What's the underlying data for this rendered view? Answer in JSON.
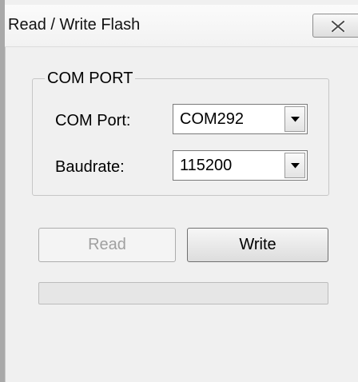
{
  "window": {
    "title": "Read / Write Flash"
  },
  "title_bar": {
    "close_icon": "close-x-icon"
  },
  "com_group": {
    "legend": "COM PORT",
    "port": {
      "label": "COM Port:",
      "value": "COM292",
      "arrow_icon": "chevron-down-icon"
    },
    "baud": {
      "label": "Baudrate:",
      "value": "115200",
      "arrow_icon": "chevron-down-icon"
    }
  },
  "buttons": {
    "read_label": "Read",
    "read_enabled": false,
    "write_label": "Write",
    "write_enabled": true
  },
  "progress": {
    "fraction": 0
  },
  "colors": {
    "window_bg": "#f0f0f0",
    "disabled_text": "#a0a0a0",
    "progress_fill": "#06b025"
  }
}
